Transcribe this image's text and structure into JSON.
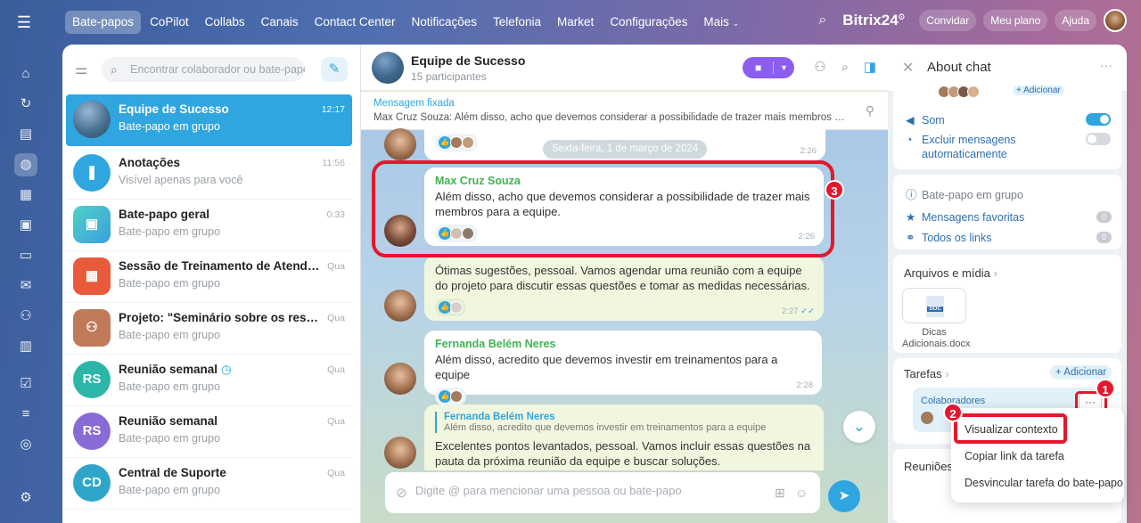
{
  "topbar": {
    "nav": [
      "Bate-papos",
      "CoPilot",
      "Collabs",
      "Canais",
      "Contact Center",
      "Notificações",
      "Telefonia",
      "Market",
      "Configurações",
      "Mais"
    ],
    "brand": "Bitrix24",
    "brand_mark": "⊙",
    "invite": "Convidar",
    "plan": "Meu plano",
    "help": "Ajuda"
  },
  "chat_list": {
    "search_placeholder": "Encontrar colaborador ou bate-papo",
    "items": [
      {
        "name": "Equipe de Sucesso",
        "sub": "Bate-papo em grupo",
        "time": "12:17"
      },
      {
        "name": "Anotações",
        "sub": "Visível apenas para você",
        "time": "11:56"
      },
      {
        "name": "Bate-papo geral",
        "sub": "Bate-papo em grupo",
        "time": "0:33"
      },
      {
        "name": "Sessão de Treinamento de Atendiment...",
        "sub": "Bate-papo em grupo",
        "time": "Qua"
      },
      {
        "name": "Projeto: \"Seminário sobre os resultado...",
        "sub": "Bate-papo em grupo",
        "time": "Qua"
      },
      {
        "name": "Reunião semanal",
        "sub": "Bate-papo em grupo",
        "time": "Qua",
        "initials": "RS"
      },
      {
        "name": "Reunião semanal",
        "sub": "Bate-papo em grupo",
        "time": "Qua",
        "initials": "RS"
      },
      {
        "name": "Central de Suporte",
        "sub": "Bate-papo em grupo",
        "time": "Qua",
        "initials": "CD"
      }
    ]
  },
  "chat": {
    "title": "Equipe de Sucesso",
    "participants": "15 participantes",
    "pinned_label": "Mensagem fixada",
    "pinned_author": "Max Cruz Souza:",
    "pinned_text": "Além disso, acho que devemos considerar a possibilidade de trazer mais membros para a e...",
    "date_divider": "Sexta-feira, 1 de março de 2024",
    "messages": [
      {
        "time": "2:26"
      },
      {
        "author": "Max Cruz Souza",
        "text": "Além disso, acho que devemos considerar a possibilidade de trazer mais membros para a equipe.",
        "time": "2:26"
      },
      {
        "text": "Ótimas sugestões, pessoal. Vamos agendar uma reunião com a equipe do projeto para discutir essas questões e tomar as medidas necessárias.",
        "time": "2:27"
      },
      {
        "author": "Fernanda Belém Neres",
        "text": "Além disso, acredito que devemos investir em treinamentos para a equipe",
        "time": "2:28"
      },
      {
        "quote_author": "Fernanda Belém Neres",
        "quote_text": "Além disso, acredito que devemos investir em treinamentos para a equipe",
        "text": "Excelentes pontos levantados, pessoal. Vamos incluir essas questões na pauta da próxima reunião da equipe e buscar soluções."
      }
    ],
    "composer_placeholder": "Digite @ para mencionar uma pessoa ou bate-papo"
  },
  "about": {
    "title": "About chat",
    "add_members": "+ Adicionar",
    "sound": "Som",
    "auto_delete": "Excluir mensagens automaticamente",
    "chat_type": "Bate-papo em grupo",
    "favorites": "Mensagens favoritas",
    "favorites_count": "0",
    "links": "Todos os links",
    "links_count": "0",
    "files_title": "Arquivos e mídia",
    "file_name": "Dicas Adicionais.docx",
    "file_ext": "DOC",
    "tasks_title": "Tarefas",
    "tasks_add": "+ Adicionar",
    "task_title": "Colaboradores",
    "meetings_title": "Reuniões"
  },
  "context_menu": {
    "items": [
      "Visualizar contexto",
      "Copiar link da tarefa",
      "Desvincular tarefa do bate-papo"
    ]
  },
  "callouts": [
    "1",
    "2",
    "3"
  ],
  "colors": {
    "accent": "#2fa6e0",
    "highlight": "#e3182d",
    "video": "#8b5ef0",
    "author": "#40b352"
  }
}
